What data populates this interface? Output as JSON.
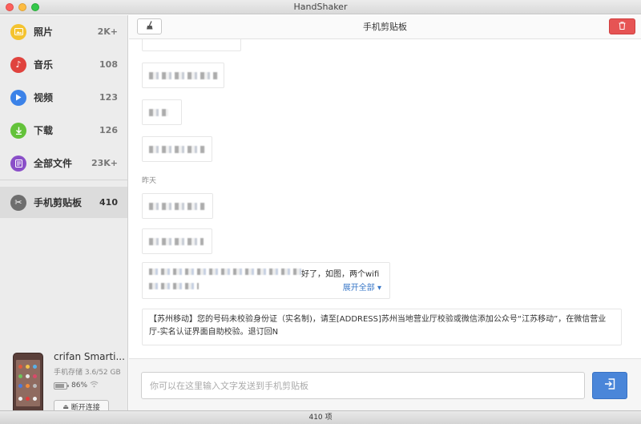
{
  "window": {
    "title": "HandShaker"
  },
  "sidebar": {
    "items": [
      {
        "label": "照片",
        "count": "2K+",
        "icon": "photo-icon",
        "color": "#f4c32f"
      },
      {
        "label": "音乐",
        "count": "108",
        "icon": "music-icon",
        "color": "#e0433e"
      },
      {
        "label": "视频",
        "count": "123",
        "icon": "video-play-icon",
        "color": "#3b82e8"
      },
      {
        "label": "下载",
        "count": "126",
        "icon": "download-icon",
        "color": "#63c23a"
      },
      {
        "label": "全部文件",
        "count": "23K+",
        "icon": "files-icon",
        "color": "#8a4fc8"
      },
      {
        "label": "手机剪贴板",
        "count": "410",
        "icon": "scissors-icon",
        "color": "#6e6e6e"
      }
    ]
  },
  "device": {
    "name": "crifan Smarti...",
    "storage": "手机存储 3.6/52 GB",
    "battery_level": 0.86,
    "battery_pct": "86%",
    "disconnect_label": "断开连接"
  },
  "main": {
    "title": "手机剪贴板",
    "date_label": "昨天",
    "preview_text": "好了，如图，两个wifi",
    "expand_label": "展开全部",
    "sms_text": "【苏州移动】您的号码未校验身份证（实名制)，请至[ADDRESS]苏州当地营业厅校验或微信添加公众号“江苏移动”，在微信营业厅-实名认证界面自助校验。退订回N",
    "input_placeholder": "你可以在这里输入文字发送到手机剪贴板"
  },
  "status": {
    "count_label": "410 项"
  },
  "colors": {
    "accent": "#4a86d9",
    "danger": "#e65454"
  }
}
